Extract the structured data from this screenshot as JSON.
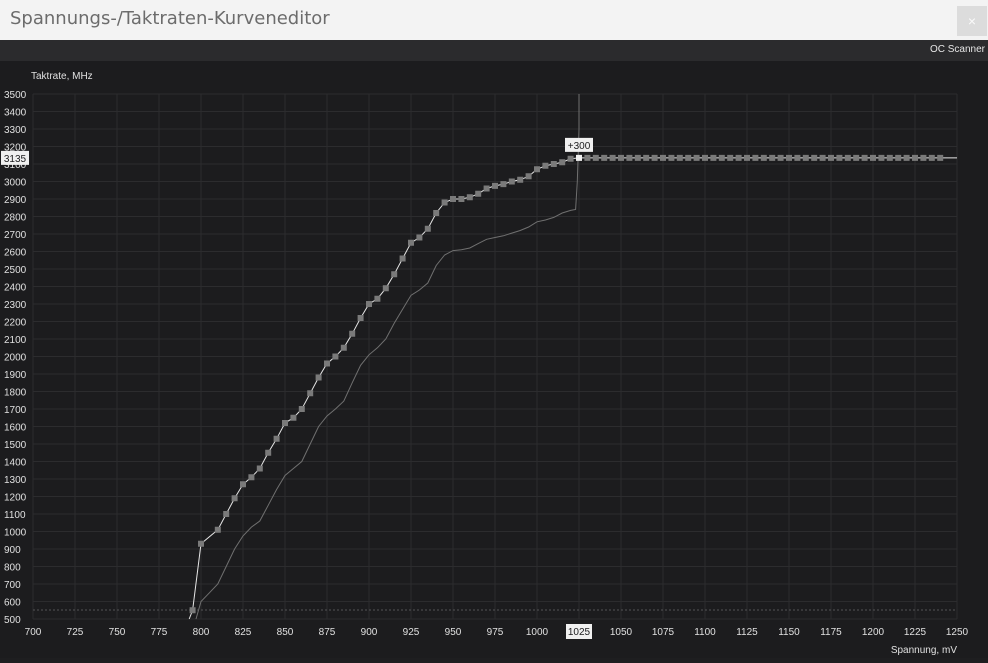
{
  "window": {
    "title": "Spannungs-/Taktraten-Kurveneditor",
    "close_label": "×"
  },
  "toolbar": {
    "oc_scanner_label": "OC Scanner"
  },
  "colors": {
    "background": "#1c1c1e",
    "grid": "#2c2c2e",
    "curve": "#e6e6e6",
    "reference": "#707070",
    "point": "#7a7a7a"
  },
  "chart_data": {
    "type": "line",
    "ylabel": "Taktrate, MHz",
    "xlabel": "Spannung, mV",
    "xlim": [
      700,
      1250
    ],
    "ylim": [
      500,
      3500
    ],
    "x_ticks": [
      700,
      725,
      750,
      775,
      800,
      825,
      850,
      875,
      900,
      925,
      950,
      975,
      1000,
      1025,
      1050,
      1075,
      1100,
      1125,
      1150,
      1175,
      1200,
      1225,
      1250
    ],
    "y_ticks": [
      500,
      600,
      700,
      800,
      900,
      1000,
      1100,
      1200,
      1300,
      1400,
      1500,
      1600,
      1700,
      1800,
      1900,
      2000,
      2100,
      2200,
      2300,
      2400,
      2500,
      2600,
      2700,
      2800,
      2900,
      3000,
      3100,
      3200,
      3300,
      3400,
      3500
    ],
    "grid": true,
    "selected": {
      "x": 1025,
      "y": 3135,
      "x_label": "1025",
      "y_label": "3135",
      "offset_label": "+300"
    },
    "series": [
      {
        "role": "curve",
        "x": [
          793,
          795,
          800,
          810,
          815,
          820,
          825,
          830,
          835,
          840,
          845,
          850,
          855,
          860,
          865,
          870,
          875,
          880,
          885,
          890,
          895,
          900,
          905,
          910,
          915,
          920,
          925,
          930,
          935,
          940,
          945,
          950,
          955,
          960,
          965,
          970,
          975,
          980,
          985,
          990,
          995,
          1000,
          1005,
          1010,
          1015,
          1020,
          1025,
          1030,
          1035,
          1040,
          1045,
          1050,
          1055,
          1060,
          1065,
          1070,
          1075,
          1080,
          1085,
          1090,
          1095,
          1100,
          1105,
          1110,
          1115,
          1120,
          1125,
          1130,
          1135,
          1140,
          1145,
          1150,
          1155,
          1160,
          1165,
          1170,
          1175,
          1180,
          1185,
          1190,
          1195,
          1200,
          1205,
          1210,
          1215,
          1220,
          1225,
          1230,
          1235,
          1240,
          1250
        ],
        "y": [
          500,
          550,
          930,
          1010,
          1100,
          1190,
          1270,
          1310,
          1360,
          1450,
          1530,
          1620,
          1650,
          1700,
          1790,
          1880,
          1960,
          2000,
          2050,
          2130,
          2220,
          2300,
          2330,
          2390,
          2470,
          2560,
          2650,
          2680,
          2730,
          2820,
          2880,
          2900,
          2900,
          2910,
          2930,
          2960,
          2975,
          2985,
          3000,
          3010,
          3030,
          3070,
          3090,
          3100,
          3110,
          3130,
          3135,
          3135,
          3135,
          3135,
          3135,
          3135,
          3135,
          3135,
          3135,
          3135,
          3135,
          3135,
          3135,
          3135,
          3135,
          3135,
          3135,
          3135,
          3135,
          3135,
          3135,
          3135,
          3135,
          3135,
          3135,
          3135,
          3135,
          3135,
          3135,
          3135,
          3135,
          3135,
          3135,
          3135,
          3135,
          3135,
          3135,
          3135,
          3135,
          3135,
          3135,
          3135,
          3135,
          3135,
          3135
        ]
      },
      {
        "role": "reference",
        "x": [
          797,
          800,
          805,
          810,
          815,
          820,
          825,
          830,
          835,
          840,
          845,
          850,
          855,
          860,
          865,
          870,
          875,
          880,
          885,
          890,
          895,
          900,
          905,
          910,
          915,
          920,
          925,
          930,
          935,
          940,
          945,
          950,
          955,
          960,
          965,
          970,
          975,
          980,
          985,
          990,
          995,
          1000,
          1005,
          1010,
          1015,
          1020,
          1023,
          1024,
          1025,
          1025
        ],
        "y": [
          500,
          600,
          650,
          700,
          800,
          900,
          975,
          1025,
          1060,
          1150,
          1240,
          1320,
          1360,
          1400,
          1500,
          1600,
          1660,
          1700,
          1745,
          1850,
          1950,
          2010,
          2050,
          2100,
          2190,
          2270,
          2350,
          2380,
          2420,
          2520,
          2580,
          2605,
          2610,
          2620,
          2645,
          2670,
          2680,
          2690,
          2705,
          2720,
          2740,
          2770,
          2780,
          2795,
          2820,
          2835,
          2840,
          3000,
          3300,
          3500
        ]
      }
    ]
  }
}
